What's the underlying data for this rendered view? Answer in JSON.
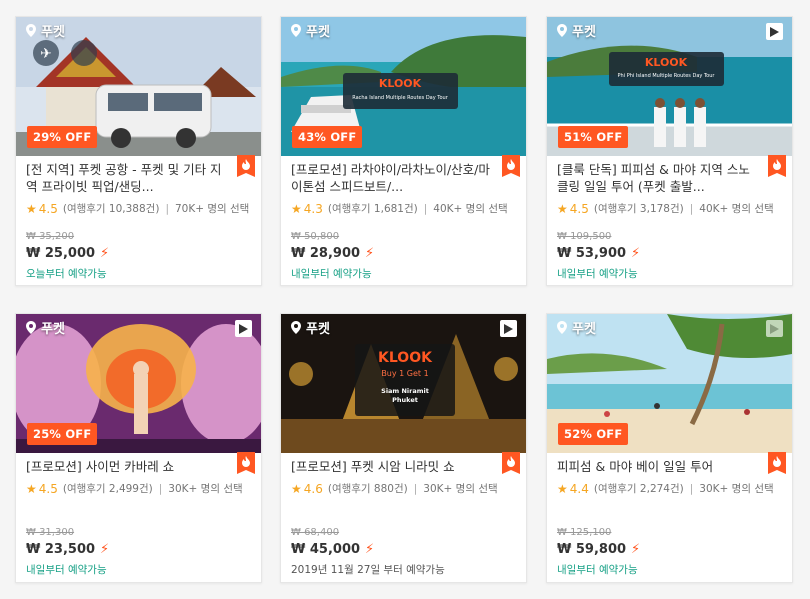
{
  "location_label": "푸켓",
  "cards": [
    {
      "title": "[전 지역] 푸켓 공항 - 푸켓 및 기타 지역 프라이빗 픽업/샌딩...",
      "discount": "29% OFF",
      "rating": "4.5",
      "reviews": "(여행후기 10,388건)",
      "popularity": "70K+ 명의 선택",
      "original_price": "₩ 35,200",
      "price": "₩ 25,000",
      "availability": "오늘부터 예약가능",
      "has_video": false,
      "thumb_theme": "van"
    },
    {
      "title": "[프로모션] 라차야이/라차노이/산호/마이톤섬 스피드보트/...",
      "discount": "43% OFF",
      "rating": "4.3",
      "reviews": "(여행후기 1,681건)",
      "popularity": "40K+ 명의 선택",
      "original_price": "₩ 50,800",
      "price": "₩ 28,900",
      "availability": "내일부터 예약가능",
      "has_video": false,
      "thumb_theme": "island",
      "banner_brand": "KLOOK",
      "banner_sub": "Racha Island Multiple Routes Day Tour"
    },
    {
      "title": "[클룩 단독] 피피섬 & 마야 지역 스노클링 일일 투어 (푸켓 출발...",
      "discount": "51% OFF",
      "rating": "4.5",
      "reviews": "(여행후기 3,178건)",
      "popularity": "40K+ 명의 선택",
      "original_price": "₩ 109,500",
      "price": "₩ 53,900",
      "availability": "내일부터 예약가능",
      "has_video": true,
      "thumb_theme": "boat",
      "banner_brand": "KLOOK",
      "banner_sub": "Phi Phi Island Multiple Routes Day Tour"
    },
    {
      "title": "[프로모션] 사이먼 카바레 쇼",
      "discount": "25% OFF",
      "rating": "4.5",
      "reviews": "(여행후기 2,499건)",
      "popularity": "30K+ 명의 선택",
      "original_price": "₩ 31,300",
      "price": "₩ 23,500",
      "availability": "내일부터 예약가능",
      "has_video": true,
      "thumb_theme": "cabaret"
    },
    {
      "title": "[프로모션] 푸켓 시암 니라밋 쇼",
      "discount": "",
      "rating": "4.6",
      "reviews": "(여행후기 880건)",
      "popularity": "30K+ 명의 선택",
      "original_price": "₩ 68,400",
      "price": "₩ 45,000",
      "availability": "2019년 11월 27일 부터 예약가능",
      "has_video": true,
      "thumb_theme": "siam",
      "banner_brand": "KLOOK",
      "banner_line1": "Buy 1 Get 1",
      "banner_line2": "Siam Niramit",
      "banner_line3": "Phuket"
    },
    {
      "title": "피피섬 & 마야 베이 일일 투어",
      "discount": "52% OFF",
      "rating": "4.4",
      "reviews": "(여행후기 2,274건)",
      "popularity": "30K+ 명의 선택",
      "original_price": "₩ 125,100",
      "price": "₩ 59,800",
      "availability": "내일부터 예약가능",
      "has_video": true,
      "thumb_theme": "beach"
    }
  ],
  "colors": {
    "accent": "#ff5722",
    "star": "#f5a623",
    "available": "#16a085"
  },
  "icons": {
    "location": "location-pin-icon",
    "video": "play-video-icon",
    "hot": "hot-flame-icon",
    "instant": "lightning-bolt-icon",
    "star": "star-icon"
  }
}
